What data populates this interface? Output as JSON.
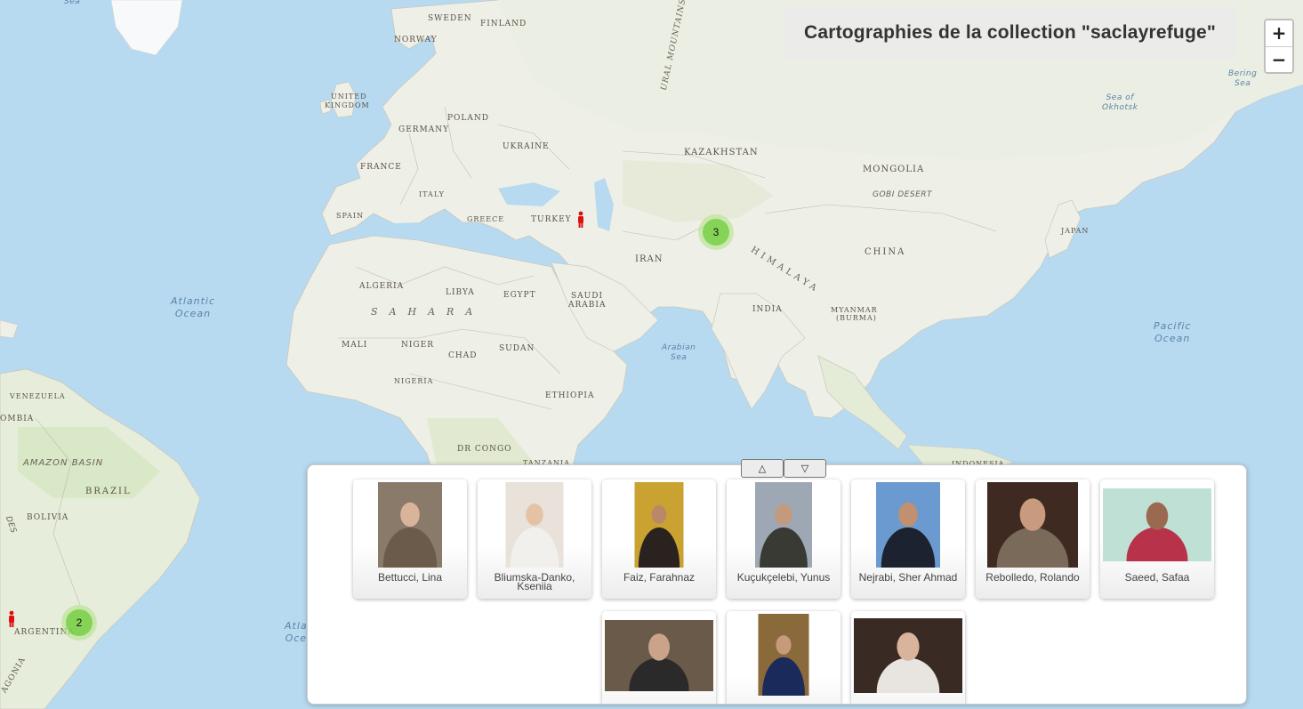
{
  "title": "Cartographies de la collection \"saclayrefuge\"",
  "zoom": {
    "in_label": "+",
    "out_label": "−"
  },
  "panel": {
    "up_label": "△",
    "down_label": "▽"
  },
  "map_labels": {
    "sweden": "SWEDEN",
    "finland": "FINLAND",
    "norway": "NORWAY",
    "united_kingdom_1": "UNITED",
    "united_kingdom_2": "KINGDOM",
    "poland": "POLAND",
    "germany": "GERMANY",
    "ukraine": "UKRAINE",
    "france": "FRANCE",
    "italy": "ITALY",
    "spain": "SPAIN",
    "greece": "GREECE",
    "turkey": "TURKEY",
    "kazakhstan": "KAZAKHSTAN",
    "mongolia": "MONGOLIA",
    "gobi": "GOBI DESERT",
    "china": "CHINA",
    "japan": "JAPAN",
    "iran": "IRAN",
    "himalaya": "HIMALAYA",
    "india": "INDIA",
    "myanmar_1": "MYANMAR",
    "myanmar_2": "(BURMA)",
    "algeria": "ALGERIA",
    "libya": "LIBYA",
    "egypt": "EGYPT",
    "saudi_1": "SAUDI",
    "saudi_2": "ARABIA",
    "sahara": "SAHARA",
    "mali": "MALI",
    "niger": "NIGER",
    "chad": "CHAD",
    "sudan": "SUDAN",
    "nigeria": "NIGERIA",
    "ethiopia": "ETHIOPIA",
    "drcongo": "DR CONGO",
    "tanzania": "TANZANIA",
    "indonesia": "INDONESIA",
    "venezuela": "VENEZUELA",
    "colombia": "OMBIA",
    "amazon": "AMAZON BASIN",
    "brazil": "BRAZIL",
    "bolivia": "BOLIVIA",
    "argentina": "ARGENTINA",
    "patagonia": "AGONIA",
    "ural": "URAL MOUNTAINS",
    "andes": "DES"
  },
  "ocean_labels": {
    "atlantic_1": "Atlantic",
    "atlantic_2": "Ocean",
    "pacific_1": "Pacific",
    "pacific_2": "Ocean",
    "arabian_1": "Arabian",
    "arabian_2": "Sea",
    "okhotsk_1": "Sea of",
    "okhotsk_2": "Okhotsk",
    "bering_1": "Bering",
    "bering_2": "Sea",
    "atl_south_1": "Atla",
    "atl_south_2": "Oce",
    "sea_top": "Sea"
  },
  "clusters": [
    {
      "count": "3",
      "region": "asia"
    },
    {
      "count": "2",
      "region": "south-america"
    }
  ],
  "markers": [
    {
      "region": "turkey"
    },
    {
      "region": "argentina"
    }
  ],
  "people": [
    {
      "name": "Bettucci, Lina",
      "bg": "#8a7a6a",
      "skin": "#d9b49a",
      "cloth": "#6b5b4a"
    },
    {
      "name": "Bliumska-Danko, Kseniia",
      "bg": "#e8e2da",
      "skin": "#e5c2a6",
      "cloth": "#f2f0ec"
    },
    {
      "name": "Faiz, Farahnaz",
      "bg": "#c9a232",
      "skin": "#b9876a",
      "cloth": "#2a221e"
    },
    {
      "name": "Kuçukçelebi, Yunus",
      "bg": "#9ea7b4",
      "skin": "#c49a7c",
      "cloth": "#3a3a34"
    },
    {
      "name": "Nejrabi, Sher Ahmad",
      "bg": "#6a9ad0",
      "skin": "#c09070",
      "cloth": "#1c2230"
    },
    {
      "name": "Rebolledo, Rolando",
      "bg": "#3e2a20",
      "skin": "#c89a7e",
      "cloth": "#7a6a5a"
    },
    {
      "name": "Saeed, Safaa",
      "bg": "#bfe1d5",
      "skin": "#9a6a50",
      "cloth": "#b8324a"
    },
    {
      "name": "",
      "bg": "#6a5a4a",
      "skin": "#c9a488",
      "cloth": "#2a2a2a"
    },
    {
      "name": "",
      "bg": "#8a6a3a",
      "skin": "#c69a7a",
      "cloth": "#1a2a5a"
    },
    {
      "name": "",
      "bg": "#3a2a24",
      "skin": "#d8b49c",
      "cloth": "#e8e4e0"
    }
  ]
}
